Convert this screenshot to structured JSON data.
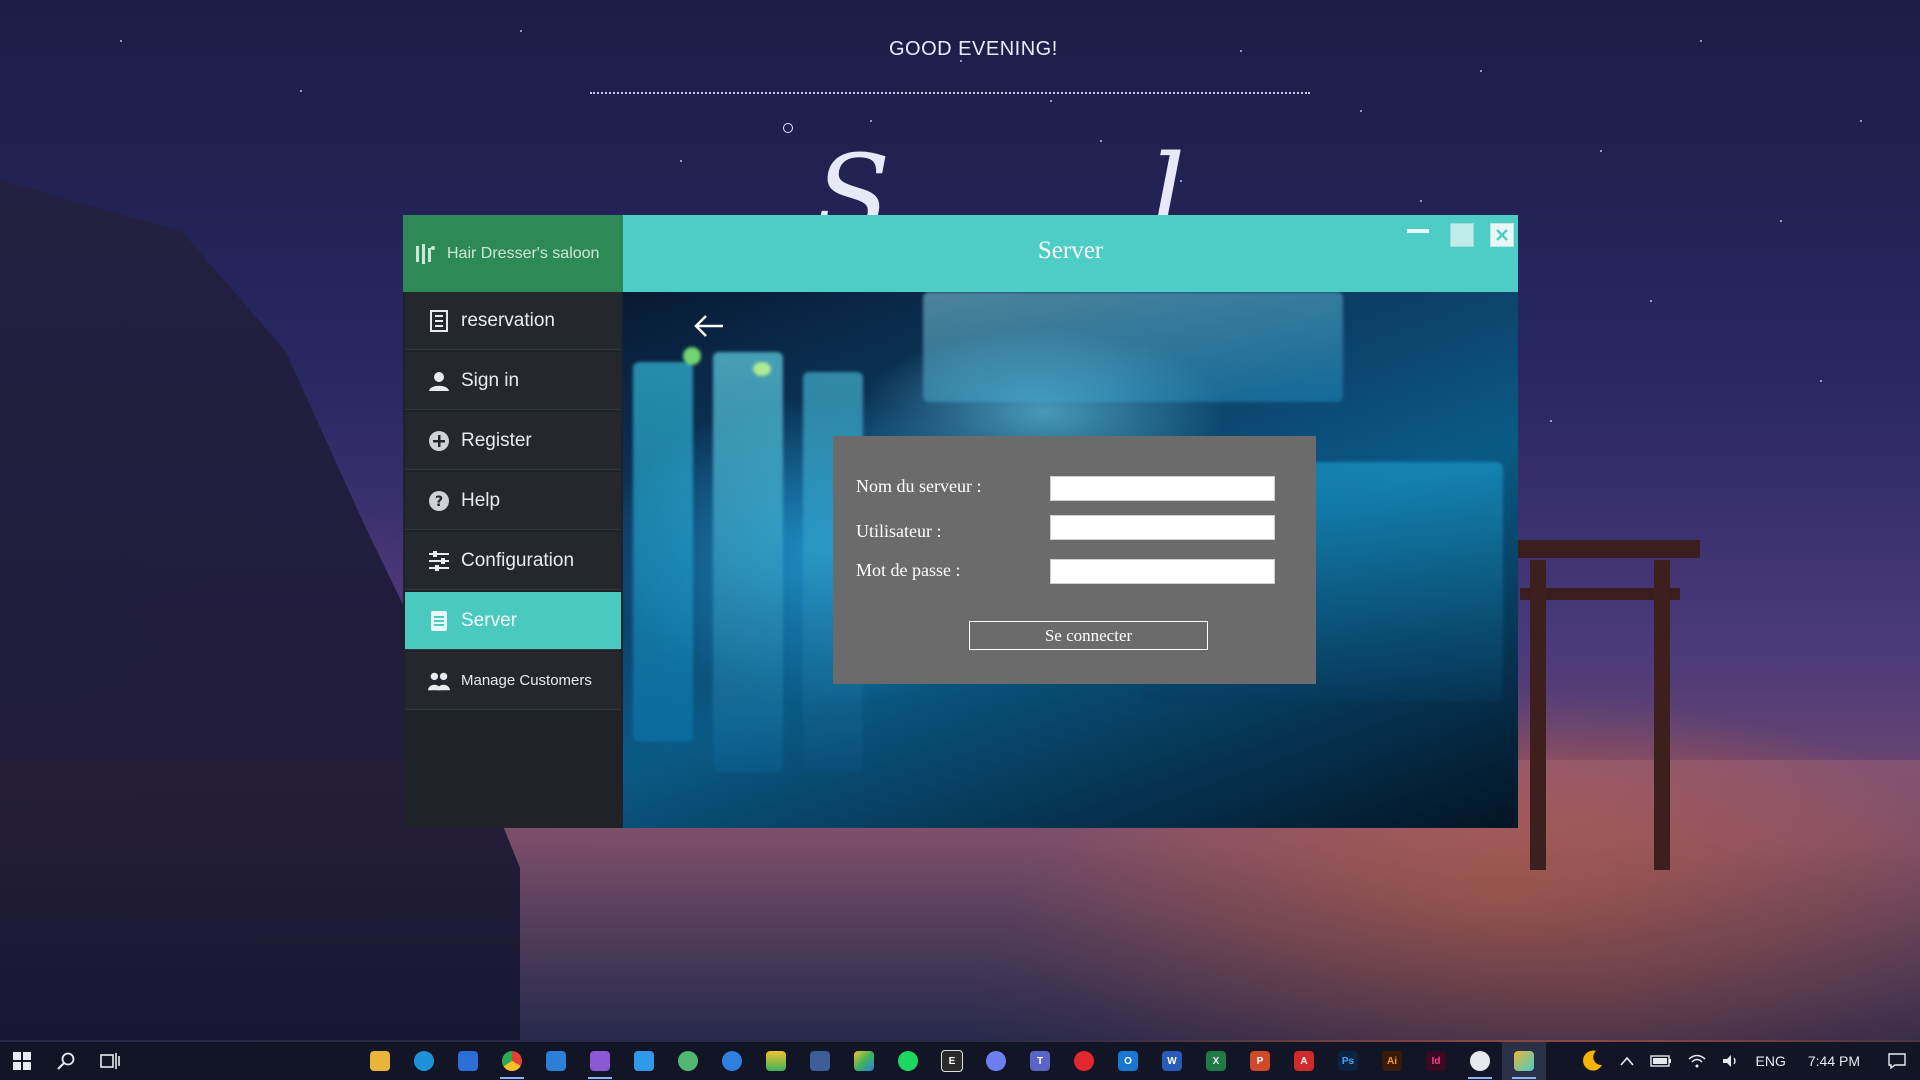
{
  "desktop": {
    "greeting": "GOOD EVENING!"
  },
  "app": {
    "brand": "Hair Dresser's saloon",
    "window_title": "Server",
    "nav": [
      {
        "label": "reservation",
        "icon": "list-icon"
      },
      {
        "label": "Sign in",
        "icon": "user-icon"
      },
      {
        "label": "Register",
        "icon": "plus-circle-icon"
      },
      {
        "label": "Help",
        "icon": "help-icon"
      },
      {
        "label": "Configuration",
        "icon": "sliders-icon"
      },
      {
        "label": "Server",
        "icon": "server-icon",
        "active": true
      },
      {
        "label": "Manage Customers",
        "icon": "users-icon"
      }
    ],
    "form": {
      "server_label": "Nom du serveur :",
      "server_value": "",
      "user_label": "Utilisateur :",
      "user_value": "",
      "password_label": "Mot de passe :",
      "password_value": "",
      "connect_label": "Se connecter"
    },
    "colors": {
      "accent": "#4dcdc6",
      "brand_header": "#2d8a56",
      "sidebar": "#1f2228"
    }
  },
  "taskbar": {
    "apps": [
      "file-explorer-icon",
      "edge-icon",
      "store-icon",
      "chrome-icon",
      "mail-icon",
      "visual-studio-icon",
      "vscode-icon",
      "app-green-icon",
      "app-blue-icon",
      "layers-icon",
      "app-puzzle-icon",
      "app-colorful-icon",
      "spotify-icon",
      "epic-icon",
      "discord-icon",
      "teams-icon",
      "opera-icon",
      "outlook-icon",
      "word-icon",
      "excel-icon",
      "powerpoint-icon",
      "acrobat-icon",
      "photoshop-icon",
      "illustrator-icon",
      "indesign-icon",
      "steam-icon",
      "hairdresser-app-icon"
    ],
    "language": "ENG",
    "time": "7:44 PM"
  }
}
